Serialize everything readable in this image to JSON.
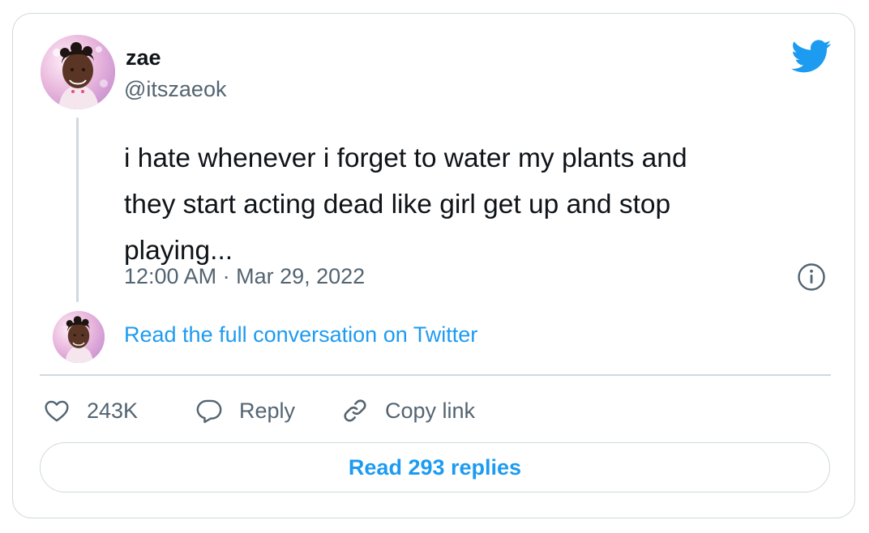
{
  "author": {
    "display_name": "zae",
    "handle": "@itszaeok"
  },
  "tweet": {
    "text_lines": [
      "i hate whenever i forget to water my plants and",
      "they start acting dead like girl get up and stop",
      "playing..."
    ],
    "timestamp": "12:00 AM · Mar 29, 2022"
  },
  "conversation_link": "Read the full conversation on Twitter",
  "actions": {
    "like_count": "243K",
    "reply_label": "Reply",
    "copy_label": "Copy link"
  },
  "read_replies_label": "Read 293 replies",
  "icons": {
    "brand": "twitter-bird-icon",
    "info": "info-icon",
    "like": "heart-icon",
    "reply": "speech-bubble-icon",
    "copy": "link-icon"
  },
  "colors": {
    "accent": "#1d9bf0",
    "text": "#0f1419",
    "secondary": "#536471",
    "border": "#cfd9de"
  }
}
